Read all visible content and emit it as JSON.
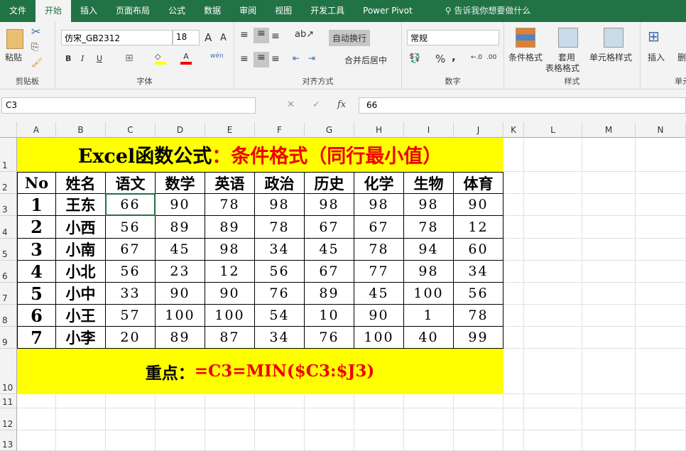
{
  "tabs": [
    "文件",
    "开始",
    "插入",
    "页面布局",
    "公式",
    "数据",
    "审阅",
    "视图",
    "开发工具",
    "Power Pivot"
  ],
  "active_tab": "开始",
  "search_placeholder": "告诉我你想要做什么",
  "ribbon": {
    "clipboard": {
      "label": "剪贴板",
      "paste": "粘贴"
    },
    "font": {
      "label": "字体",
      "name": "仿宋_GB2312",
      "size": "18",
      "bold": "B",
      "italic": "I",
      "underline": "U"
    },
    "alignment": {
      "label": "对齐方式",
      "wrap": "自动换行",
      "merge": "合并后居中"
    },
    "number": {
      "label": "数字",
      "format": "常规",
      "percent": "%",
      "comma": ","
    },
    "styles": {
      "label": "样式",
      "conditional": "条件格式",
      "table1": "套用",
      "table2": "表格格式",
      "cell": "单元格样式"
    },
    "cells": {
      "label": "单元",
      "insert": "插入",
      "delete": "删"
    }
  },
  "formula_bar": {
    "name_box": "C3",
    "fx": "fx",
    "formula": "66"
  },
  "columns": [
    "A",
    "B",
    "C",
    "D",
    "E",
    "F",
    "G",
    "H",
    "I",
    "J",
    "K",
    "L",
    "M",
    "N"
  ],
  "rows": [
    "1",
    "2",
    "3",
    "4",
    "5",
    "6",
    "7",
    "8",
    "9",
    "10",
    "11",
    "12",
    "13"
  ],
  "sheet": {
    "title_black": "Excel函数公式",
    "title_red": "：条件格式（同行最小值）",
    "headers": [
      "No",
      "姓名",
      "语文",
      "数学",
      "英语",
      "政治",
      "历史",
      "化学",
      "生物",
      "体育"
    ],
    "data": [
      [
        "1",
        "王东",
        "66",
        "90",
        "78",
        "98",
        "98",
        "98",
        "98",
        "90"
      ],
      [
        "2",
        "小西",
        "56",
        "89",
        "89",
        "78",
        "67",
        "67",
        "78",
        "12"
      ],
      [
        "3",
        "小南",
        "67",
        "45",
        "98",
        "34",
        "45",
        "78",
        "94",
        "60"
      ],
      [
        "4",
        "小北",
        "56",
        "23",
        "12",
        "56",
        "67",
        "77",
        "98",
        "34"
      ],
      [
        "5",
        "小中",
        "33",
        "90",
        "90",
        "76",
        "89",
        "45",
        "100",
        "56"
      ],
      [
        "6",
        "小王",
        "57",
        "100",
        "100",
        "54",
        "10",
        "90",
        "1",
        "78"
      ],
      [
        "7",
        "小李",
        "20",
        "89",
        "87",
        "34",
        "76",
        "100",
        "40",
        "99"
      ]
    ],
    "note_label": "重点：",
    "note_formula": "=C3=MIN($C3:$J3)"
  }
}
